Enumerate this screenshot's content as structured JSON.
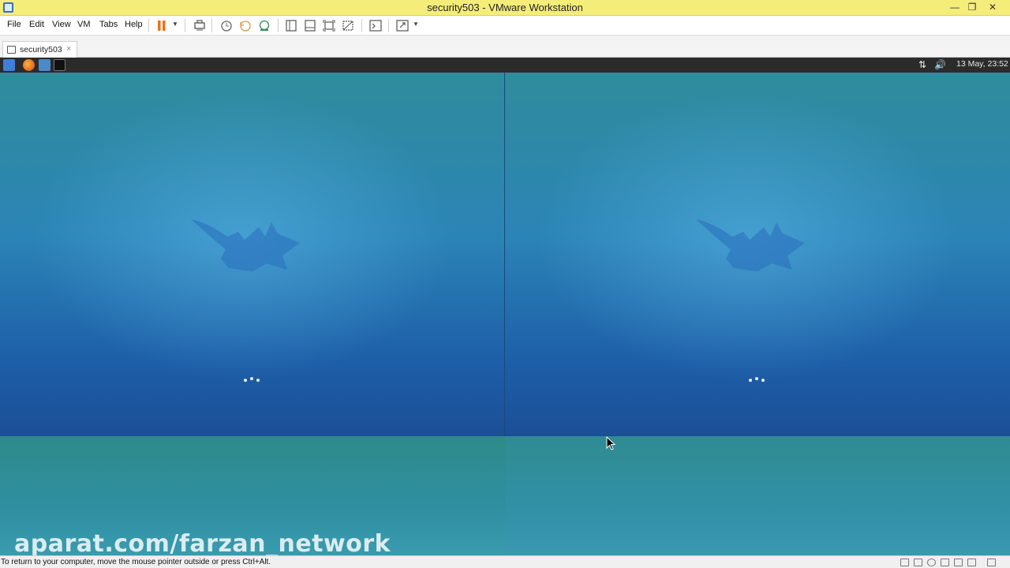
{
  "window": {
    "title": "security503 - VMware Workstation",
    "controls": {
      "minimize": "—",
      "restore": "❐",
      "close": "✕"
    }
  },
  "menu": {
    "file": "File",
    "edit": "Edit",
    "view": "View",
    "vm": "VM",
    "tabs": "Tabs",
    "help": "Help"
  },
  "toolbar": {
    "icons": [
      "pause-icon",
      "send-ctrl-alt-del-icon",
      "snapshot-icon",
      "revert-snapshot-icon",
      "snapshot-manager-icon",
      "library-icon",
      "thumbnail-bar-icon",
      "full-screen-icon",
      "unity-icon",
      "console-view-icon",
      "stretch-icon"
    ]
  },
  "tab": {
    "label": "security503",
    "close": "×"
  },
  "guest": {
    "clock": "13 May, 23:52",
    "launchers": [
      "xfce-menu-icon",
      "firefox-icon",
      "file-manager-icon",
      "terminal-icon"
    ]
  },
  "watermark": "aparat.com/farzan_network",
  "statusbar": {
    "message": "To return to your computer, move the mouse pointer outside or press Ctrl+Alt."
  },
  "colors": {
    "titlebar": "#f5ed7a",
    "guest_panel": "#2b2b2b",
    "desktop_blue": "#2b84b6",
    "pause_orange": "#e8731a"
  }
}
